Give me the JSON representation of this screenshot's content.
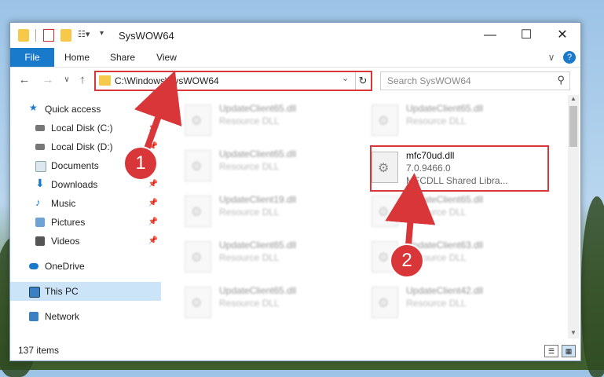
{
  "window": {
    "title": "SysWOW64",
    "controls": {
      "minimize": "—",
      "maximize": "☐",
      "close": "✕"
    }
  },
  "ribbon": {
    "tabs": [
      "File",
      "Home",
      "Share",
      "View"
    ],
    "expand_icon": "∨",
    "help_icon": "?"
  },
  "nav": {
    "back": "←",
    "forward": "→",
    "recent": "∨",
    "up": "↑",
    "address": "C:\\Windows\\SysWOW64",
    "address_dropdown": "⌄",
    "refresh": "↻",
    "search_placeholder": "Search SysWOW64",
    "search_icon": "⚲"
  },
  "sidebar": {
    "items": [
      {
        "label": "Quick access",
        "icon": "star-icon",
        "pinned": false
      },
      {
        "label": "Local Disk (C:)",
        "icon": "drive-icon",
        "pinned": true
      },
      {
        "label": "Local Disk (D:)",
        "icon": "drive-icon",
        "pinned": true
      },
      {
        "label": "Documents",
        "icon": "documents-icon",
        "pinned": true
      },
      {
        "label": "Downloads",
        "icon": "downloads-icon",
        "pinned": true
      },
      {
        "label": "Music",
        "icon": "music-icon",
        "pinned": true
      },
      {
        "label": "Pictures",
        "icon": "pictures-icon",
        "pinned": true
      },
      {
        "label": "Videos",
        "icon": "videos-icon",
        "pinned": true
      },
      {
        "label": "OneDrive",
        "icon": "onedrive-icon",
        "pinned": false
      },
      {
        "label": "This PC",
        "icon": "pc-icon",
        "pinned": false,
        "selected": true
      },
      {
        "label": "Network",
        "icon": "network-icon",
        "pinned": false
      }
    ],
    "pin_glyph": "📌"
  },
  "files": {
    "left": [
      {
        "name": "UpdateClient65.dll",
        "type": "Resource DLL"
      },
      {
        "name": "UpdateClient65.dll",
        "type": "Resource DLL"
      },
      {
        "name": "UpdateClient19.dll",
        "type": "Resource DLL"
      },
      {
        "name": "UpdateClient65.dll",
        "type": "Resource DLL"
      },
      {
        "name": "UpdateClient65.dll",
        "type": "Resource DLL"
      }
    ],
    "right": [
      {
        "name": "UpdateClient65.dll",
        "type": "Resource DLL"
      },
      {
        "name": "mfc70ud.dll",
        "version": "7.0.9466.0",
        "type": "MFCDLL Shared Libra...",
        "highlighted": true
      },
      {
        "name": "UpdateClient65.dll",
        "type": "Resource DLL"
      },
      {
        "name": "UpdateClient63.dll",
        "type": "Resource DLL"
      },
      {
        "name": "UpdateClient42.dll",
        "type": "Resource DLL"
      }
    ]
  },
  "status": {
    "count": "137 items"
  },
  "annotations": {
    "step1": "1",
    "step2": "2",
    "color": "#d9363a"
  },
  "colors": {
    "accent": "#1979ca",
    "highlight": "#d9363a",
    "selected": "#cce4f7"
  }
}
